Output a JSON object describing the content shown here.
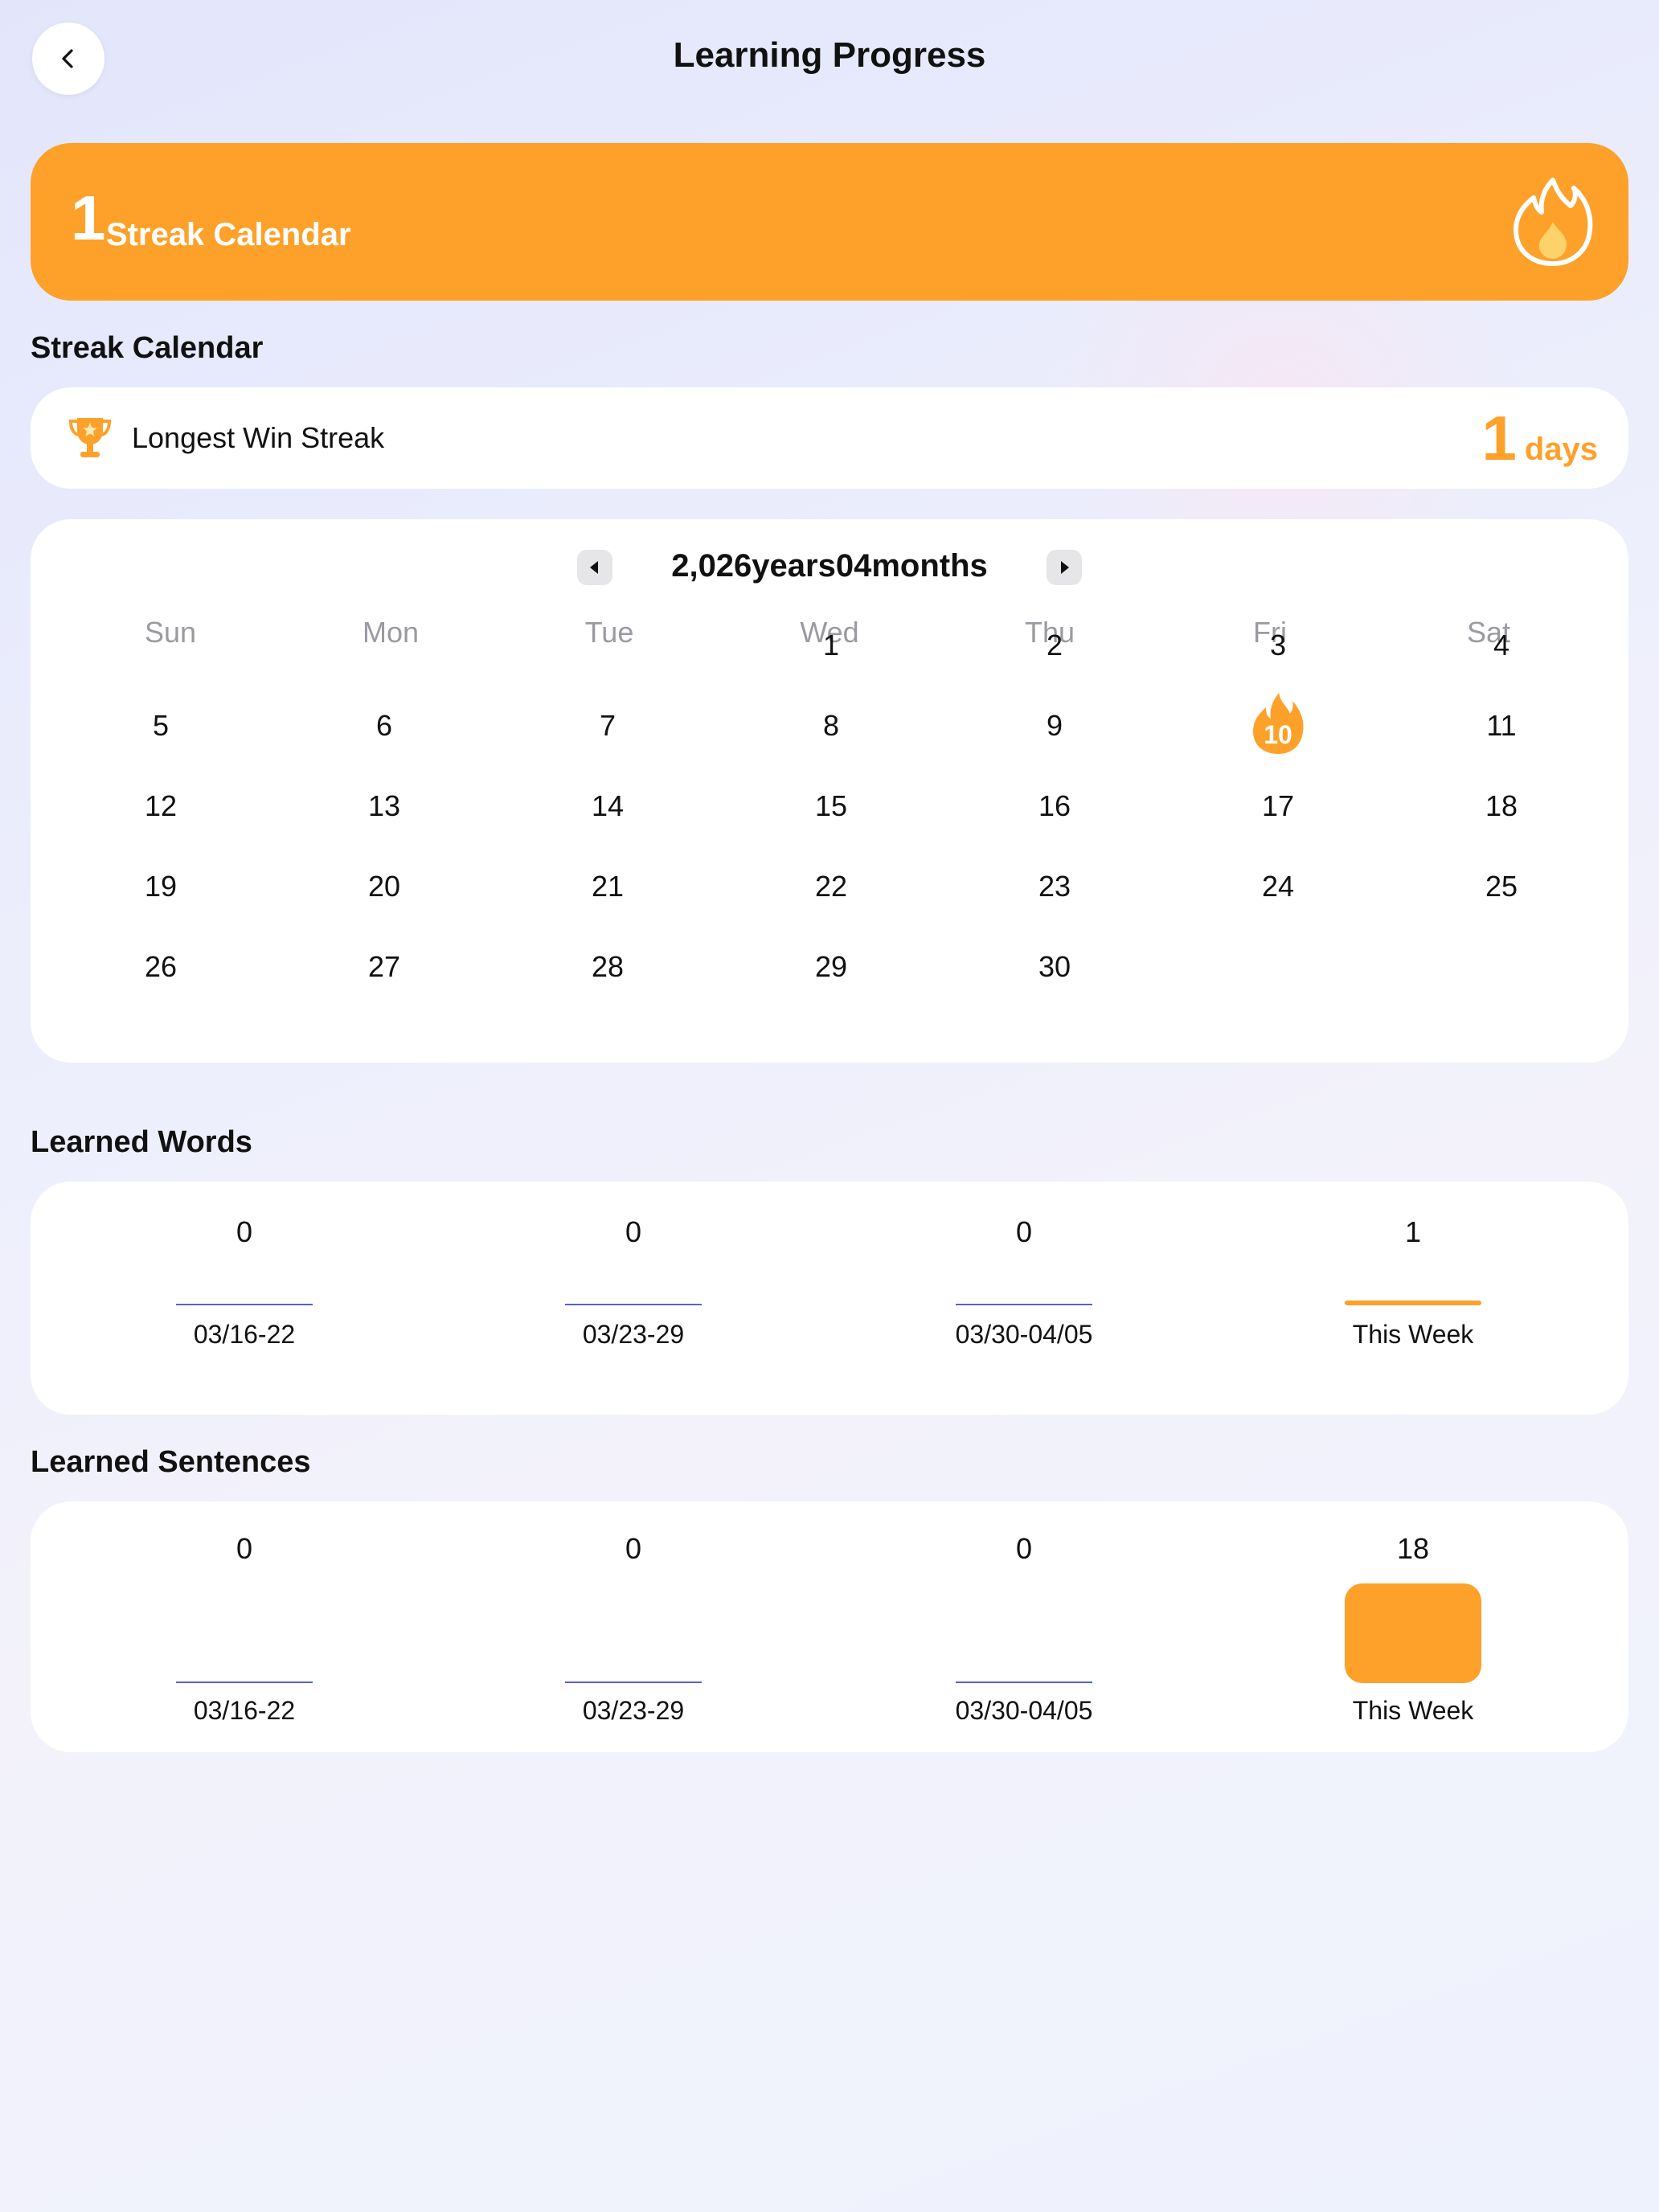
{
  "header": {
    "title": "Learning Progress"
  },
  "banner": {
    "count": "1",
    "label": "Streak Calendar"
  },
  "streak_section": {
    "title": "Streak Calendar"
  },
  "streak": {
    "label": "Longest Win Streak",
    "value": "1",
    "unit": "days"
  },
  "calendar": {
    "month_label": "2,026years04months",
    "weekdays": [
      "Sun",
      "Mon",
      "Tue",
      "Wed",
      "Thu",
      "Fri",
      "Sat"
    ],
    "weeks": [
      [
        "",
        "",
        "",
        "1",
        "2",
        "3",
        "4"
      ],
      [
        "5",
        "6",
        "7",
        "8",
        "9",
        "10",
        "11"
      ],
      [
        "12",
        "13",
        "14",
        "15",
        "16",
        "17",
        "18"
      ],
      [
        "19",
        "20",
        "21",
        "22",
        "23",
        "24",
        "25"
      ],
      [
        "26",
        "27",
        "28",
        "29",
        "30",
        "",
        ""
      ]
    ],
    "streak_day": "10"
  },
  "learned_words": {
    "title": "Learned Words",
    "columns": [
      {
        "label": "03/16-22",
        "value": "0"
      },
      {
        "label": "03/23-29",
        "value": "0"
      },
      {
        "label": "03/30-04/05",
        "value": "0"
      },
      {
        "label": "This Week",
        "value": "1"
      }
    ]
  },
  "learned_sentences": {
    "title": "Learned Sentences",
    "columns": [
      {
        "label": "03/16-22",
        "value": "0"
      },
      {
        "label": "03/23-29",
        "value": "0"
      },
      {
        "label": "03/30-04/05",
        "value": "0"
      },
      {
        "label": "This Week",
        "value": "18"
      }
    ]
  },
  "colors": {
    "accent": "#fda12a",
    "zero_line": "#5561d8",
    "muted": "#9a9aa2"
  }
}
